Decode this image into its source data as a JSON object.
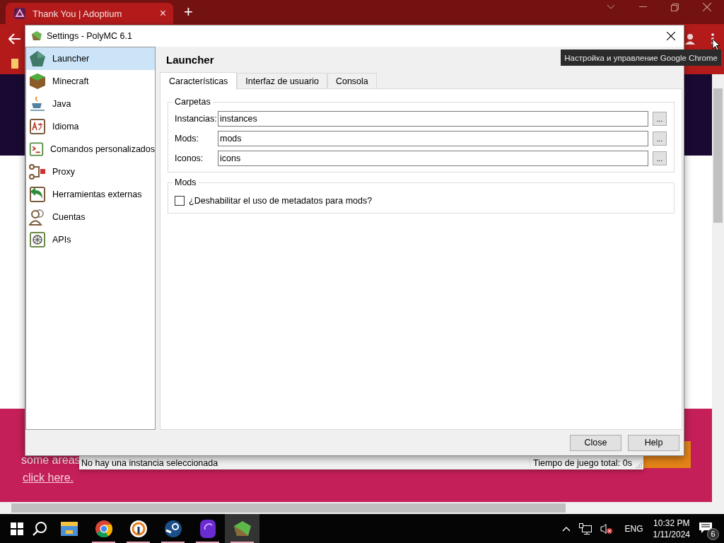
{
  "browser": {
    "tabs": [
      {
        "title": "Thank You | Adoptium",
        "close": "×",
        "selected": true
      }
    ],
    "new_tab": "+",
    "tooltip": "Настройка и управление Google Chrome",
    "page": {
      "lines": [
        "some areas"
      ],
      "link": "click here."
    }
  },
  "dialog": {
    "title": "Settings - PolyMC 6.1",
    "sidebar": {
      "items": [
        {
          "label": "Launcher",
          "kind": "launcher",
          "selected": true
        },
        {
          "label": "Minecraft",
          "kind": "minecraft",
          "selected": false
        },
        {
          "label": "Java",
          "kind": "java",
          "selected": false
        },
        {
          "label": "Idioma",
          "kind": "language",
          "selected": false
        },
        {
          "label": "Comandos personalizados",
          "kind": "terminal",
          "selected": false
        },
        {
          "label": "Proxy",
          "kind": "proxy",
          "selected": false
        },
        {
          "label": "Herramientas externas",
          "kind": "tools",
          "selected": false
        },
        {
          "label": "Cuentas",
          "kind": "accounts",
          "selected": false
        },
        {
          "label": "APIs",
          "kind": "apis",
          "selected": false
        }
      ]
    },
    "heading": "Launcher",
    "tabs": [
      {
        "label": "Características",
        "selected": true
      },
      {
        "label": "Interfaz de usuario",
        "selected": false
      },
      {
        "label": "Consola",
        "selected": false
      }
    ],
    "folders": {
      "title": "Carpetas",
      "rows": [
        {
          "label": "Instancias:",
          "value": "instances",
          "browse": "..."
        },
        {
          "label": "Mods:",
          "value": "mods",
          "browse": "..."
        },
        {
          "label": "Iconos:",
          "value": "icons",
          "browse": "..."
        }
      ]
    },
    "mods": {
      "title": "Mods",
      "checkbox": {
        "label": "¿Deshabilitar el uso de metadatos para mods?",
        "checked": false
      }
    },
    "buttons": [
      "Close",
      "Help"
    ]
  },
  "status_bar": {
    "left": "No hay una instancia seleccionada",
    "right": "Tiempo de juego total: 0s"
  },
  "taskbar": {
    "apps": [
      {
        "kind": "explorer",
        "running": false,
        "active": false
      },
      {
        "kind": "chrome",
        "running": true,
        "active": false
      },
      {
        "kind": "vpn",
        "running": true,
        "active": false
      },
      {
        "kind": "steam",
        "running": true,
        "active": false
      },
      {
        "kind": "purple",
        "running": true,
        "active": false
      },
      {
        "kind": "polymc",
        "running": true,
        "active": true
      }
    ],
    "language": "ENG",
    "time": "10:32 PM",
    "date": "1/11/2024",
    "notifications": "6"
  }
}
